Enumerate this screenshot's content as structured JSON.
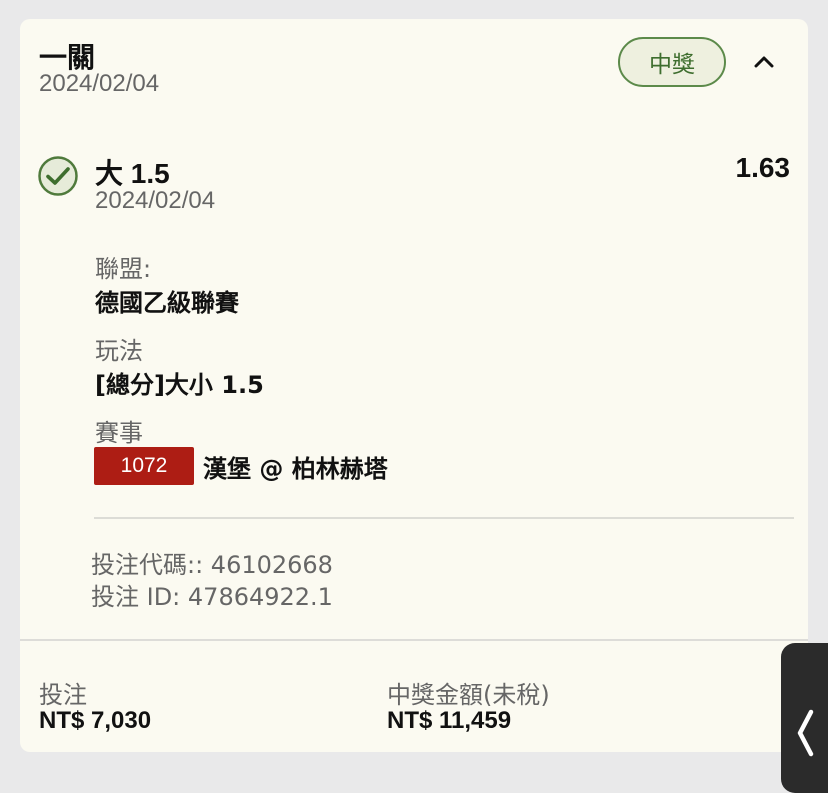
{
  "bet": {
    "type_title": "一關",
    "date": "2024/02/04",
    "status_badge": "中獎",
    "collapse_icon": "chevron-up-icon"
  },
  "selection": {
    "status_icon": "check-circle-icon",
    "name": "大 1.5",
    "date": "2024/02/04",
    "odds": "1.63",
    "league_label": "聯盟:",
    "league_value": "德國乙級聯賽",
    "market_label": "玩法",
    "market_value": "[總分]大小 1.5",
    "event_label": "賽事",
    "event_code": "1072",
    "event_name": "漢堡 @ 柏林赫塔"
  },
  "meta": {
    "bet_code": "投注代碼:: 46102668",
    "bet_id": "投注 ID: 47864922.1"
  },
  "footer": {
    "stake_label": "投注",
    "stake_value": "NT$ 7,030",
    "payout_label": "中獎金額(未稅)",
    "payout_value": "NT$ 11,459"
  },
  "side_tab": {
    "icon": "chevron-left-icon"
  },
  "colors": {
    "card_bg": "#fbfaf1",
    "win_green": "#4f7a3c",
    "event_red": "#ad1d14",
    "page_bg": "#e9e9ea"
  }
}
